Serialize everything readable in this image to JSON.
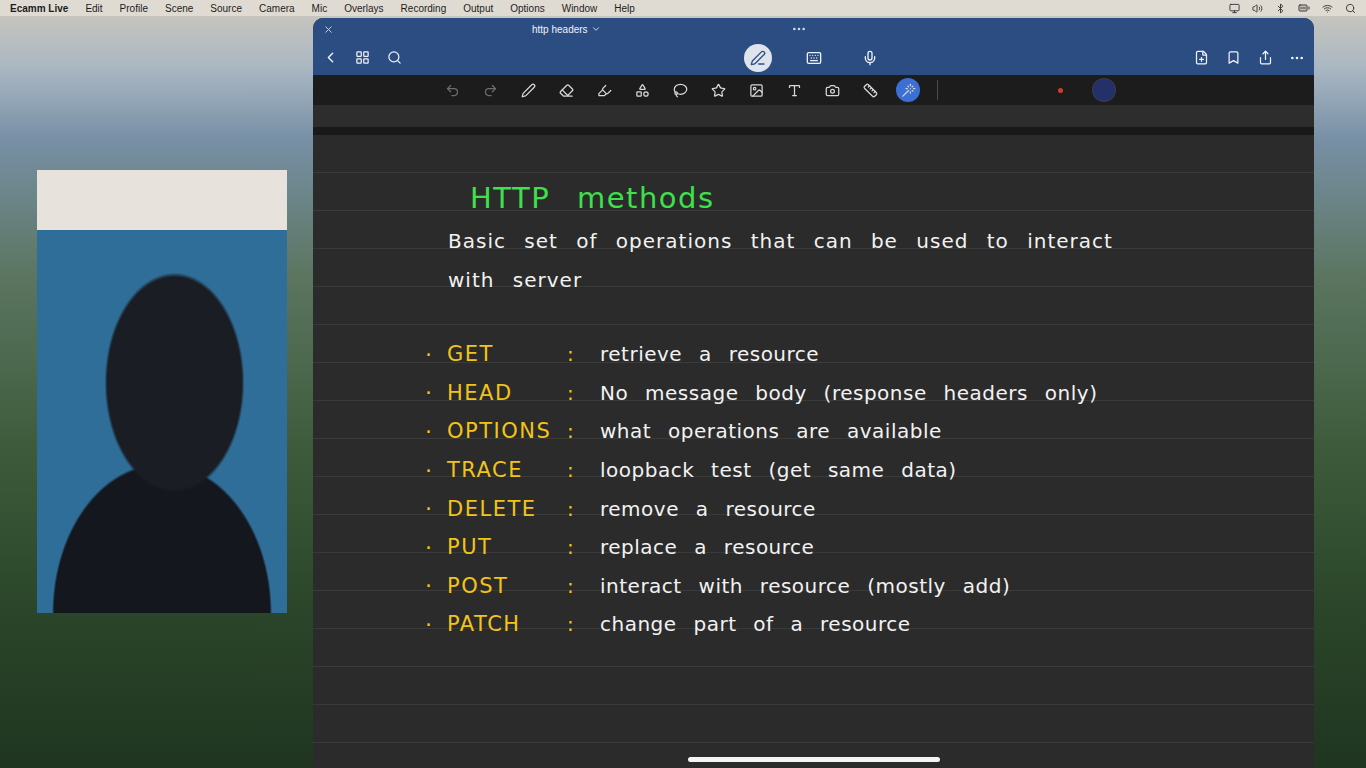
{
  "menu_bar": {
    "app": "Ecamm Live",
    "menus": [
      "Edit",
      "Profile",
      "Scene",
      "Source",
      "Camera",
      "Mic",
      "Overlays",
      "Recording",
      "Output",
      "Options",
      "Window",
      "Help"
    ]
  },
  "window": {
    "title": "http headers"
  },
  "title_bar": {
    "modes": [
      {
        "kind": "pen",
        "selected": true
      },
      {
        "kind": "keyboard",
        "selected": false
      },
      {
        "kind": "mic",
        "selected": false
      }
    ]
  },
  "toolbar": {
    "tools": [
      {
        "kind": "undo",
        "selected": false,
        "disabled": true
      },
      {
        "kind": "redo",
        "selected": false,
        "disabled": true
      },
      {
        "kind": "pen",
        "selected": false,
        "disabled": false
      },
      {
        "kind": "eraser",
        "selected": false,
        "disabled": false
      },
      {
        "kind": "highlighter",
        "selected": false,
        "disabled": false
      },
      {
        "kind": "shapes",
        "selected": false,
        "disabled": false
      },
      {
        "kind": "lasso",
        "selected": false,
        "disabled": false
      },
      {
        "kind": "elements",
        "selected": false,
        "disabled": false
      },
      {
        "kind": "image",
        "selected": false,
        "disabled": false
      },
      {
        "kind": "text",
        "selected": false,
        "disabled": false
      },
      {
        "kind": "camera",
        "selected": false,
        "disabled": false
      },
      {
        "kind": "ruler",
        "selected": false,
        "disabled": false
      },
      {
        "kind": "laser",
        "selected": true,
        "disabled": false
      }
    ],
    "swatches": [
      {
        "color": "#d23a2e",
        "selected": false
      },
      {
        "color": "#24306a",
        "selected": true
      }
    ]
  },
  "note": {
    "heading": "HTTP methods",
    "description": [
      "Basic set of operations that can be used to interact",
      "with server"
    ],
    "bullet": "·",
    "separator": ":",
    "methods": [
      {
        "method": "GET",
        "description": "retrieve a resource"
      },
      {
        "method": "HEAD",
        "description": "No message body (response headers only)"
      },
      {
        "method": "OPTIONS",
        "description": "what operations are available"
      },
      {
        "method": "TRACE",
        "description": "loopback test (get same data)"
      },
      {
        "method": "DELETE",
        "description": "remove a resource"
      },
      {
        "method": "PUT",
        "description": "replace a resource"
      },
      {
        "method": "POST",
        "description": "interact with resource (mostly add)"
      },
      {
        "method": "PATCH",
        "description": "change part of a resource"
      }
    ]
  }
}
